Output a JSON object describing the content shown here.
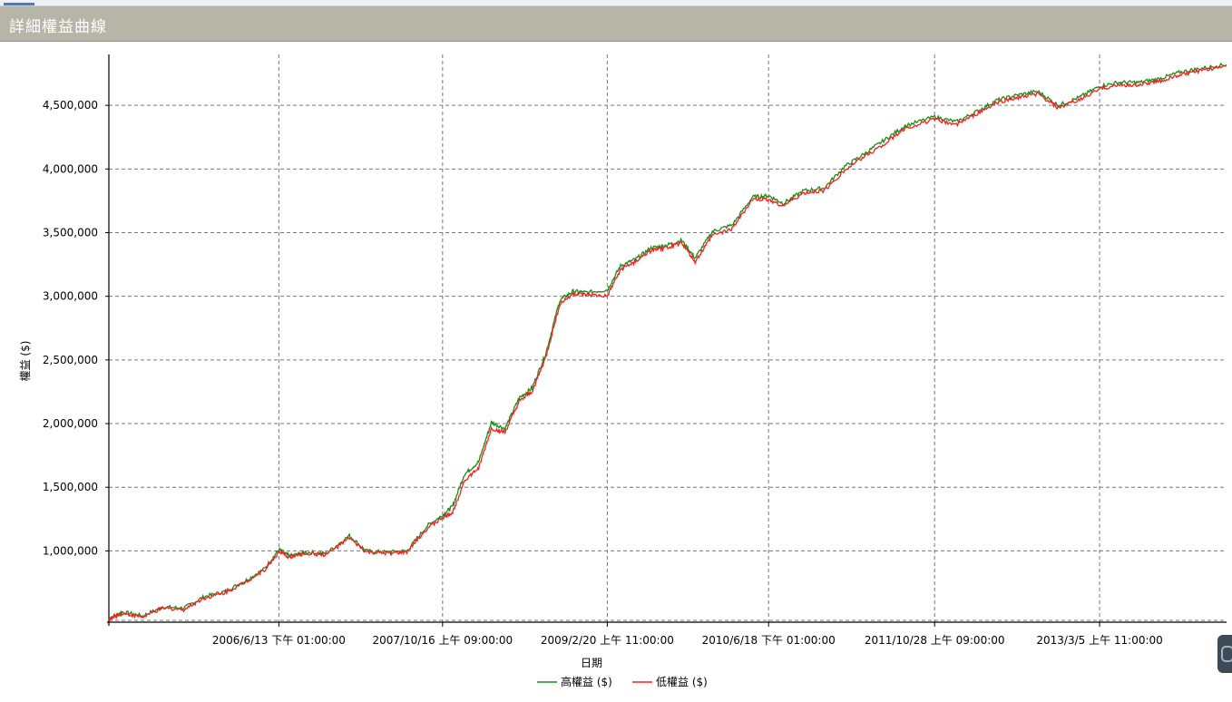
{
  "window": {
    "title": "詳細權益曲線"
  },
  "chart_data": {
    "type": "line",
    "title": "",
    "xlabel": "日期",
    "ylabel": "權益 ($)",
    "ylim": [
      440000,
      4900000
    ],
    "yticks": [
      1000000,
      1500000,
      2000000,
      2500000,
      3000000,
      3500000,
      4000000,
      4500000
    ],
    "ytick_labels": [
      "1,000,000",
      "1,500,000",
      "2,000,000",
      "2,500,000",
      "3,000,000",
      "3,500,000",
      "4,000,000",
      "4,500,000"
    ],
    "xticks": [
      "2006/6/13 下午 01:00:00",
      "2007/10/16 上午 09:00:00",
      "2009/2/20 上午 11:00:00",
      "2010/6/18 下午 01:00:00",
      "2011/10/28 上午 09:00:00",
      "2013/3/5 上午 11:00:00"
    ],
    "xlim": [
      "2005-01-20",
      "2014-03-20"
    ],
    "xtick_dates": [
      "2006-06-13",
      "2007-10-16",
      "2009-02-20",
      "2010-06-18",
      "2011-10-28",
      "2013-03-05"
    ],
    "grid": true,
    "legend_position": "bottom-center",
    "series": [
      {
        "name": "高權益 ($)",
        "color": "#1a8c1a",
        "x": [
          "2005-01-20",
          "2005-03-01",
          "2005-05-01",
          "2005-07-01",
          "2005-09-01",
          "2005-11-01",
          "2006-01-01",
          "2006-03-01",
          "2006-05-01",
          "2006-06-13",
          "2006-07-15",
          "2006-09-01",
          "2006-11-01",
          "2007-01-10",
          "2007-03-01",
          "2007-05-01",
          "2007-07-01",
          "2007-09-01",
          "2007-10-16",
          "2007-11-15",
          "2007-12-20",
          "2008-02-01",
          "2008-03-10",
          "2008-04-20",
          "2008-06-01",
          "2008-07-10",
          "2008-08-20",
          "2008-10-01",
          "2008-11-10",
          "2008-12-20",
          "2009-02-20",
          "2009-04-01",
          "2009-05-15",
          "2009-07-01",
          "2009-08-15",
          "2009-10-01",
          "2009-11-10",
          "2010-01-01",
          "2010-03-01",
          "2010-05-01",
          "2010-06-18",
          "2010-08-01",
          "2010-10-01",
          "2010-12-01",
          "2011-02-01",
          "2011-04-01",
          "2011-06-01",
          "2011-08-01",
          "2011-10-28",
          "2012-01-01",
          "2012-03-01",
          "2012-05-01",
          "2012-07-01",
          "2012-09-01",
          "2012-11-01",
          "2013-01-01",
          "2013-03-05",
          "2013-05-01",
          "2013-07-01",
          "2013-09-01",
          "2013-11-01",
          "2014-01-01",
          "2014-03-20"
        ],
        "values": [
          470000,
          520000,
          490000,
          560000,
          550000,
          640000,
          680000,
          760000,
          860000,
          1010000,
          960000,
          990000,
          980000,
          1120000,
          1000000,
          990000,
          1000000,
          1200000,
          1280000,
          1350000,
          1600000,
          1700000,
          2010000,
          1960000,
          2200000,
          2280000,
          2550000,
          2970000,
          3040000,
          3030000,
          3050000,
          3240000,
          3290000,
          3380000,
          3400000,
          3440000,
          3300000,
          3510000,
          3560000,
          3780000,
          3790000,
          3730000,
          3830000,
          3850000,
          4020000,
          4120000,
          4230000,
          4340000,
          4410000,
          4370000,
          4450000,
          4540000,
          4580000,
          4610000,
          4500000,
          4560000,
          4650000,
          4680000,
          4680000,
          4710000,
          4760000,
          4790000,
          4820000
        ]
      },
      {
        "name": "低權益 ($)",
        "color": "#ff1a1a",
        "x": [
          "2005-01-20",
          "2005-03-01",
          "2005-05-01",
          "2005-07-01",
          "2005-09-01",
          "2005-11-01",
          "2006-01-01",
          "2006-03-01",
          "2006-05-01",
          "2006-06-13",
          "2006-07-15",
          "2006-09-01",
          "2006-11-01",
          "2007-01-10",
          "2007-03-01",
          "2007-05-01",
          "2007-07-01",
          "2007-09-01",
          "2007-10-16",
          "2007-11-15",
          "2007-12-20",
          "2008-02-01",
          "2008-03-10",
          "2008-04-20",
          "2008-06-01",
          "2008-07-10",
          "2008-08-20",
          "2008-10-01",
          "2008-11-10",
          "2008-12-20",
          "2009-02-20",
          "2009-04-01",
          "2009-05-15",
          "2009-07-01",
          "2009-08-15",
          "2009-10-01",
          "2009-11-10",
          "2010-01-01",
          "2010-03-01",
          "2010-05-01",
          "2010-06-18",
          "2010-08-01",
          "2010-10-01",
          "2010-12-01",
          "2011-02-01",
          "2011-04-01",
          "2011-06-01",
          "2011-08-01",
          "2011-10-28",
          "2012-01-01",
          "2012-03-01",
          "2012-05-01",
          "2012-07-01",
          "2012-09-01",
          "2012-11-01",
          "2013-01-01",
          "2013-03-05",
          "2013-05-01",
          "2013-07-01",
          "2013-09-01",
          "2013-11-01",
          "2014-01-01",
          "2014-03-20"
        ],
        "values": [
          460000,
          510000,
          480000,
          550000,
          540000,
          630000,
          670000,
          750000,
          850000,
          990000,
          950000,
          980000,
          970000,
          1100000,
          990000,
          980000,
          990000,
          1180000,
          1260000,
          1300000,
          1550000,
          1650000,
          1960000,
          1930000,
          2170000,
          2250000,
          2520000,
          2940000,
          3020000,
          3010000,
          3000000,
          3210000,
          3270000,
          3360000,
          3380000,
          3420000,
          3270000,
          3480000,
          3530000,
          3760000,
          3760000,
          3710000,
          3810000,
          3830000,
          3990000,
          4100000,
          4200000,
          4320000,
          4390000,
          4350000,
          4430000,
          4520000,
          4560000,
          4590000,
          4480000,
          4540000,
          4630000,
          4660000,
          4660000,
          4690000,
          4740000,
          4770000,
          4810000
        ]
      }
    ]
  }
}
